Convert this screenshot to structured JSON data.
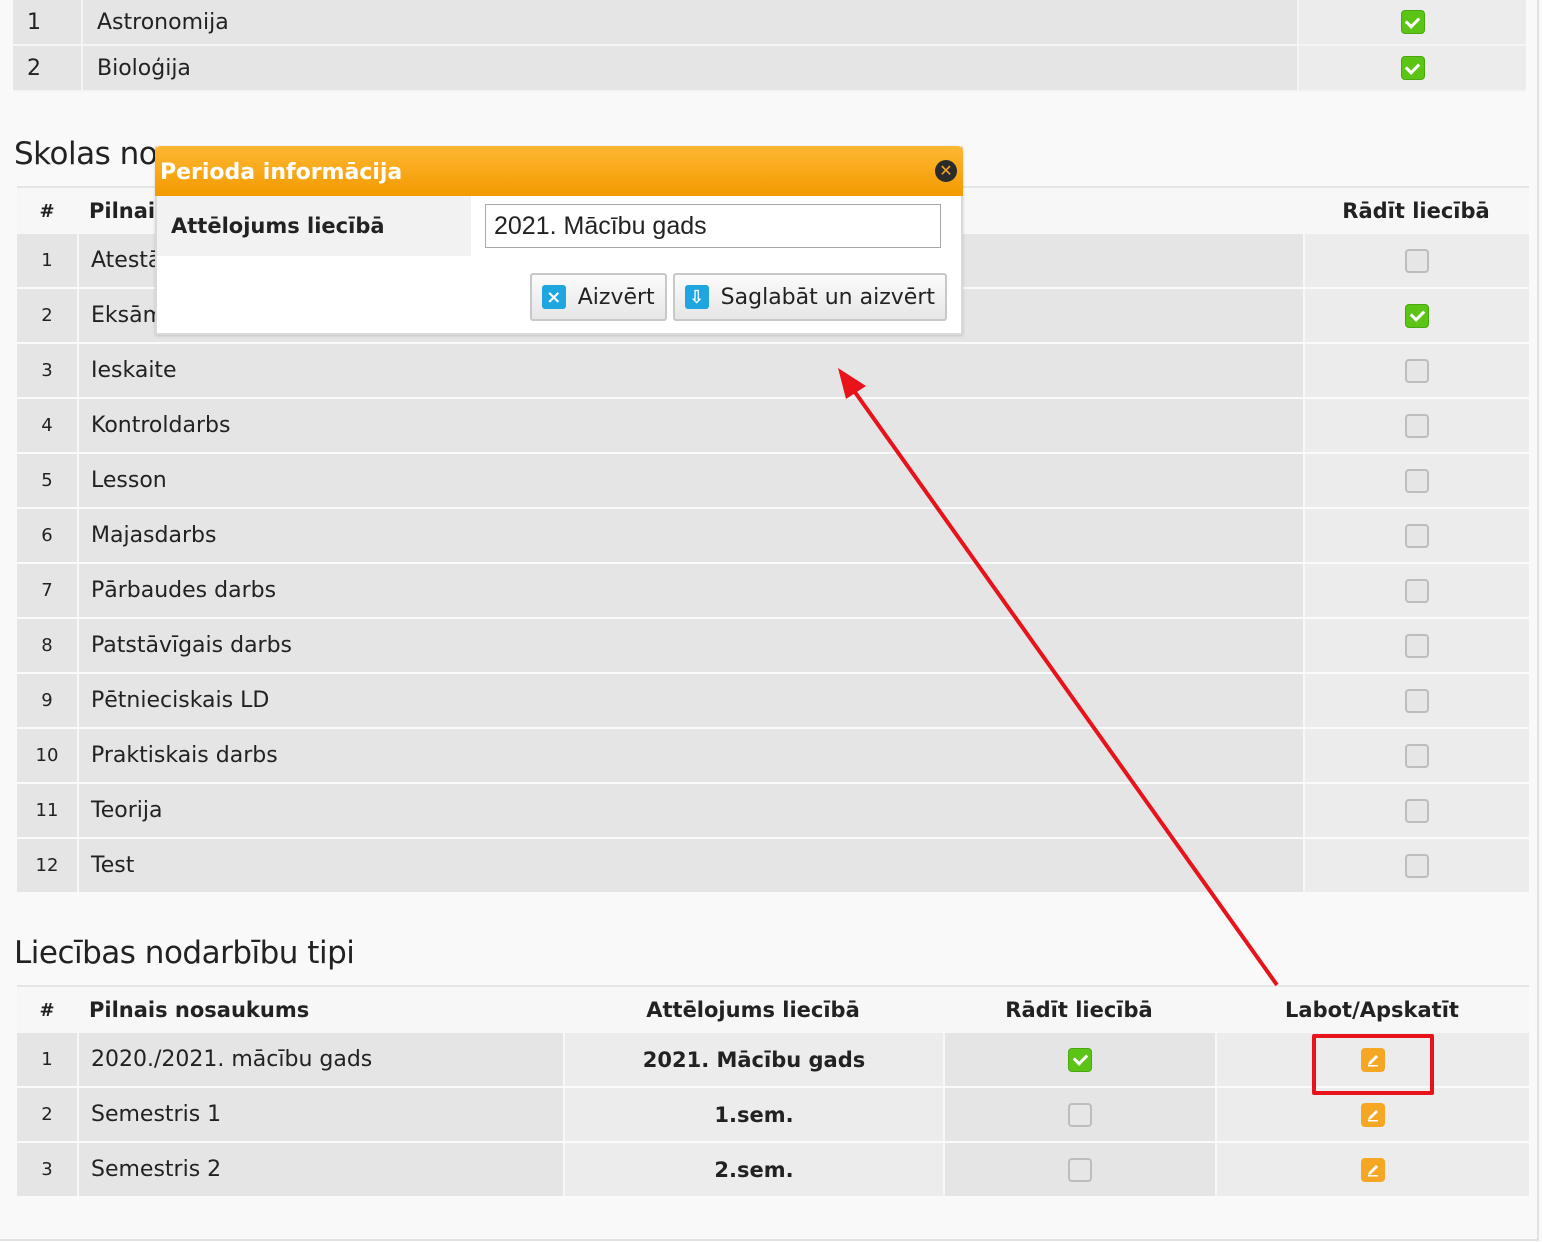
{
  "subjects": {
    "rows": [
      {
        "num": "1",
        "name": "Astronomija",
        "checked": true
      },
      {
        "num": "2",
        "name": "Bioloģija",
        "checked": true
      }
    ]
  },
  "school_types": {
    "title": "Skolas nodarbību tipi",
    "title_visible": "Skolas no",
    "headers": {
      "num": "#",
      "name": "Pilnais nosaukums",
      "name_visible": "Pilnais",
      "show": "Rādīt liecībā"
    },
    "rows": [
      {
        "num": "1",
        "name": "Atestācija",
        "name_visible": "Atestā",
        "checked": false
      },
      {
        "num": "2",
        "name": "Eksāmens",
        "name_visible": "Eksām",
        "checked": true
      },
      {
        "num": "3",
        "name": "Ieskaite",
        "checked": false
      },
      {
        "num": "4",
        "name": "Kontroldarbs",
        "checked": false
      },
      {
        "num": "5",
        "name": "Lesson",
        "checked": false
      },
      {
        "num": "6",
        "name": "Majasdarbs",
        "checked": false
      },
      {
        "num": "7",
        "name": "Pārbaudes darbs",
        "checked": false
      },
      {
        "num": "8",
        "name": "Patstāvīgais darbs",
        "checked": false
      },
      {
        "num": "9",
        "name": "Pētnieciskais LD",
        "checked": false
      },
      {
        "num": "10",
        "name": "Praktiskais darbs",
        "checked": false
      },
      {
        "num": "11",
        "name": "Teorija",
        "checked": false
      },
      {
        "num": "12",
        "name": "Test",
        "checked": false
      }
    ]
  },
  "report_types": {
    "title": "Liecības nodarbību tipi",
    "headers": {
      "num": "#",
      "name": "Pilnais nosaukums",
      "display": "Attēlojums liecībā",
      "show": "Rādīt liecībā",
      "edit": "Labot/Apskatīt"
    },
    "rows": [
      {
        "num": "1",
        "name": "2020./2021. mācību gads",
        "display": "2021. Mācību gads",
        "checked": true,
        "edit_icon": "edit-pencil-icon"
      },
      {
        "num": "2",
        "name": "Semestris 1",
        "display": "1.sem.",
        "checked": false,
        "edit_icon": "edit-pencil-icon"
      },
      {
        "num": "3",
        "name": "Semestris 2",
        "display": "2.sem.",
        "checked": false,
        "edit_icon": "edit-pencil-icon"
      }
    ]
  },
  "modal": {
    "title": "Perioda informācija",
    "field_label": "Attēlojums liecībā",
    "field_value": "2021. Mācību gads",
    "close_button": "Aizvērt",
    "save_button": "Saglabāt un aizvērt"
  },
  "annotation": {
    "color": "#e8131a"
  }
}
